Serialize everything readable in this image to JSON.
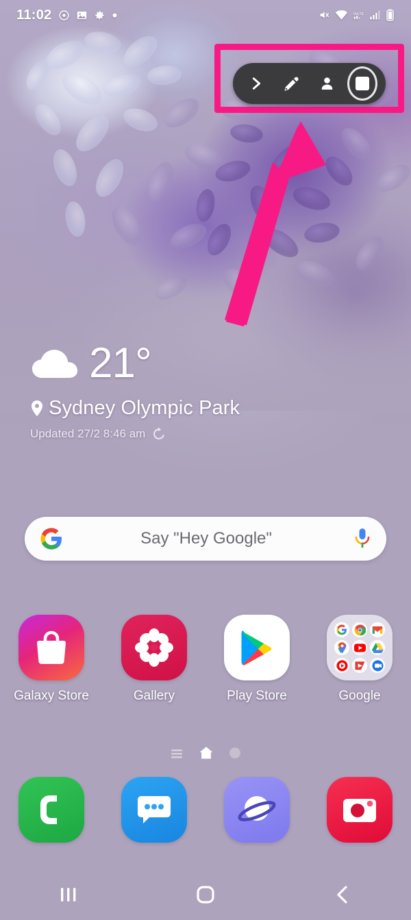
{
  "device": {
    "platform": "Samsung One UI Android home screen",
    "background_color": "#ada3bc"
  },
  "status_bar": {
    "clock": "11:02",
    "left_icons": [
      "eye-icon",
      "image-icon",
      "gear-icon",
      "dot-icon"
    ],
    "right_icons": [
      "mute-icon",
      "wifi-icon",
      "volte-icon",
      "signal-icon",
      "battery-icon"
    ]
  },
  "annotation": {
    "highlight_color": "#f81a84",
    "arrow_color": "#f81a84",
    "target": "screen-recorder-toolbar"
  },
  "recorder_toolbar": {
    "background_color": "#3b3b3e",
    "buttons": [
      {
        "name": "expand-button",
        "icon": "chevron-right-icon",
        "label": "Expand"
      },
      {
        "name": "draw-button",
        "icon": "pencil-icon",
        "label": "Draw"
      },
      {
        "name": "selfie-button",
        "icon": "person-icon",
        "label": "Selfie video"
      },
      {
        "name": "stop-button",
        "icon": "stop-square-icon",
        "label": "Stop"
      }
    ]
  },
  "weather_widget": {
    "condition_icon": "cloud-icon",
    "temperature": "21°",
    "location": "Sydney Olympic Park",
    "updated": "Updated 27/2 8:46 am",
    "refresh_icon": "refresh-icon"
  },
  "search": {
    "logo": "google-g-icon",
    "placeholder": "Say \"Hey Google\"",
    "mic_icon": "microphone-icon"
  },
  "apps": [
    {
      "name": "galaxy-store",
      "label": "Galaxy Store",
      "icon": "shopping-bag-icon",
      "color": "#e8316e"
    },
    {
      "name": "gallery",
      "label": "Gallery",
      "icon": "flower-icon",
      "color": "#da1d52"
    },
    {
      "name": "play-store",
      "label": "Play Store",
      "icon": "play-triangle-icon",
      "color": "#ffffff"
    },
    {
      "name": "google-folder",
      "label": "Google",
      "icon": "folder-icon",
      "color": "#eeecf3"
    }
  ],
  "google_folder_apps": [
    "google-icon",
    "chrome-icon",
    "gmail-icon",
    "maps-icon",
    "youtube-icon",
    "drive-icon",
    "youtube-music-icon",
    "play-movies-icon",
    "duo-icon"
  ],
  "page_indicator": {
    "pages": [
      "lines-page-icon",
      "home-page-icon",
      "dot-page-icon"
    ],
    "active_index": 1
  },
  "dock": [
    {
      "name": "phone",
      "label": "Phone",
      "icon": "phone-icon",
      "color": "#25b24b"
    },
    {
      "name": "messages",
      "label": "Messages",
      "icon": "chat-bubble-icon",
      "color": "#2196ee"
    },
    {
      "name": "internet",
      "label": "Internet",
      "icon": "planet-icon",
      "color": "#8a86f0"
    },
    {
      "name": "camera",
      "label": "Camera",
      "icon": "camera-icon",
      "color": "#f01f42"
    }
  ],
  "nav_bar": [
    {
      "name": "recents",
      "label": "Recents",
      "icon": "recents-icon"
    },
    {
      "name": "home",
      "label": "Home",
      "icon": "home-square-icon"
    },
    {
      "name": "back",
      "label": "Back",
      "icon": "back-chevron-icon"
    }
  ]
}
